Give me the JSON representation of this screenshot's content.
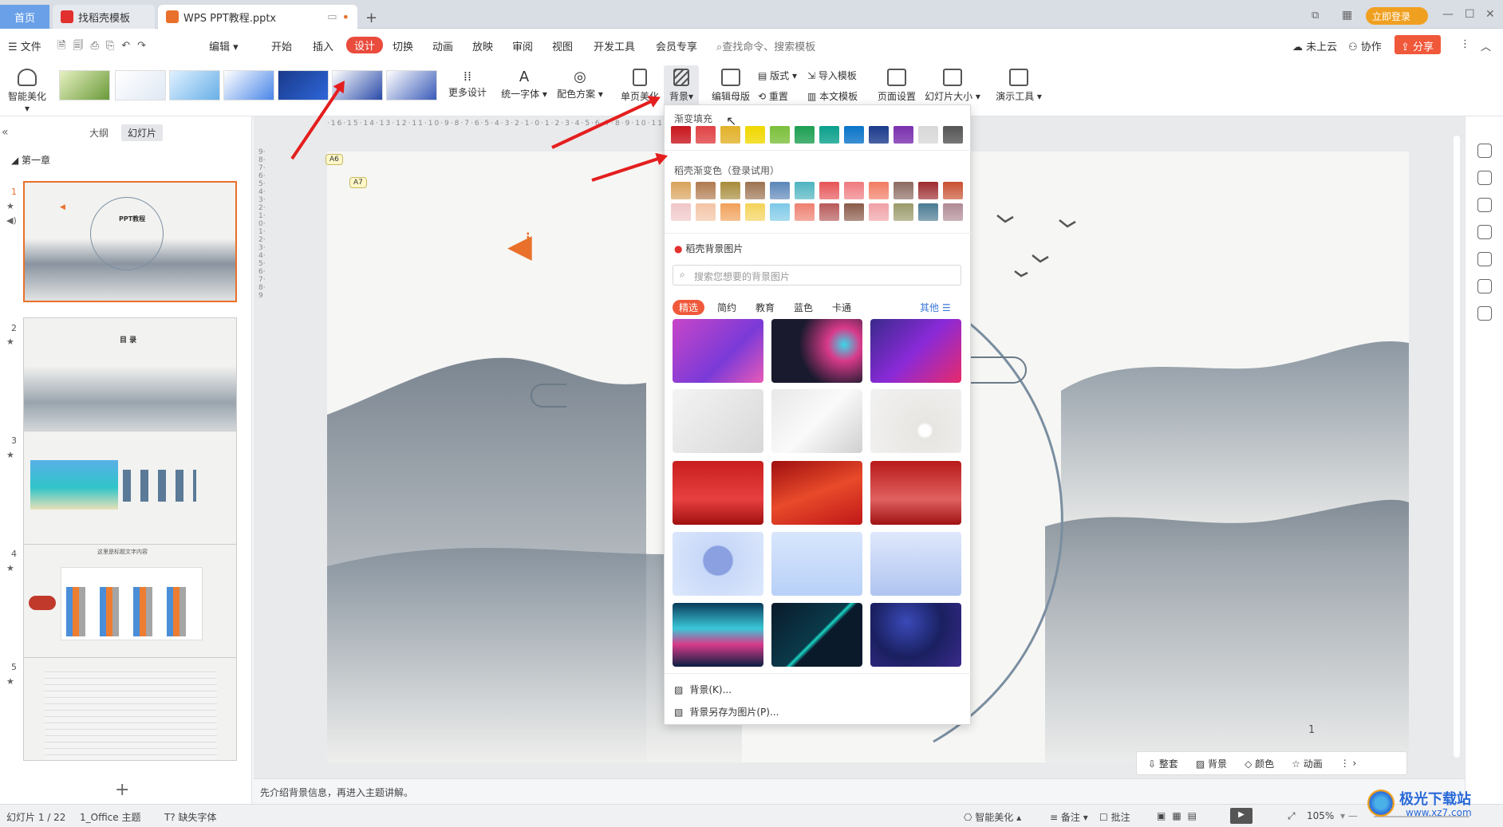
{
  "titlebar": {
    "home_tab": "首页",
    "tab2": "找稻壳模板",
    "tab3": "WPS PPT教程.pptx",
    "login_button": "立即登录"
  },
  "menubar": {
    "file": "文件",
    "edit": "编辑",
    "items": [
      "开始",
      "插入",
      "设计",
      "切换",
      "动画",
      "放映",
      "审阅",
      "视图",
      "开发工具",
      "会员专享"
    ],
    "search_placeholder": "查找命令、搜索模板",
    "cloud": "未上云",
    "collab": "协作",
    "share": "分享"
  },
  "ribbon": {
    "smart_beautify": "智能美化",
    "more_design": "更多设计",
    "unify_font": "统一字体",
    "color_scheme": "配色方案",
    "single_page": "单页美化",
    "background": "背景",
    "edit_master": "编辑母版",
    "layout": "版式",
    "reset": "重置",
    "import_template": "导入模板",
    "this_template": "本文模板",
    "page_setup": "页面设置",
    "slide_size": "幻灯片大小",
    "present_tools": "演示工具"
  },
  "leftpanel": {
    "outline_tab": "大纲",
    "slides_tab": "幻灯片",
    "section": "第一章",
    "slide_numbers": [
      "1",
      "2",
      "3",
      "4",
      "5"
    ],
    "thumb1_title": "PPT教程",
    "thumb2_title": "目 录",
    "thumb4_title": "这里是标题文字内容"
  },
  "canvas": {
    "tag1": "A6",
    "tag2": "A7",
    "page_number": "1",
    "notes_text": "先介绍背景信息，再进入主题讲解。"
  },
  "dropdown": {
    "gradient_fill_title": "渐变填充",
    "gradient_colors": [
      "#c8161d",
      "#e04245",
      "#e2b12a",
      "#f0d800",
      "#7bbf3a",
      "#1d9f52",
      "#0aa08c",
      "#0a74c8",
      "#1c3b8c",
      "#7a2fae",
      "#d8d8d8",
      "#555555"
    ],
    "docer_gradient_title": "稻壳渐变色（登录试用）",
    "docer_row1": [
      "#d9a25a",
      "#b07a4e",
      "#a78b3a",
      "#9c7250",
      "#5b86b8",
      "#4db3c0",
      "#e65356",
      "#ef7a7f",
      "#f17b62",
      "#8b6a60",
      "#9c2a2e",
      "#c85030"
    ],
    "docer_row2": [
      "#f0c6c8",
      "#f3c4a5",
      "#f0a058",
      "#f4d35a",
      "#7cc9e8",
      "#ee8070",
      "#b85a5a",
      "#8a5a48",
      "#f0a0a6",
      "#9a9a6a",
      "#4a7a92",
      "#b08a94"
    ],
    "docer_bg_title": "稻壳背景图片",
    "search_placeholder": "搜索您想要的背景图片",
    "categories": [
      "精选",
      "简约",
      "教育",
      "蓝色",
      "卡通"
    ],
    "other": "其他",
    "bg_item": "背景(K)...",
    "save_bg_item": "背景另存为图片(P)..."
  },
  "floating_toolbar": {
    "whole_set": "整套",
    "background": "背景",
    "color": "颜色",
    "animation": "动画"
  },
  "statusbar": {
    "slide_count": "幻灯片 1 / 22",
    "theme": "1_Office 主题",
    "missing_font": "缺失字体",
    "smart": "智能美化",
    "notes": "备注",
    "comments": "批注",
    "zoom": "105%"
  },
  "watermark": {
    "site": "极光下载站",
    "url": "www.xz7.com"
  }
}
